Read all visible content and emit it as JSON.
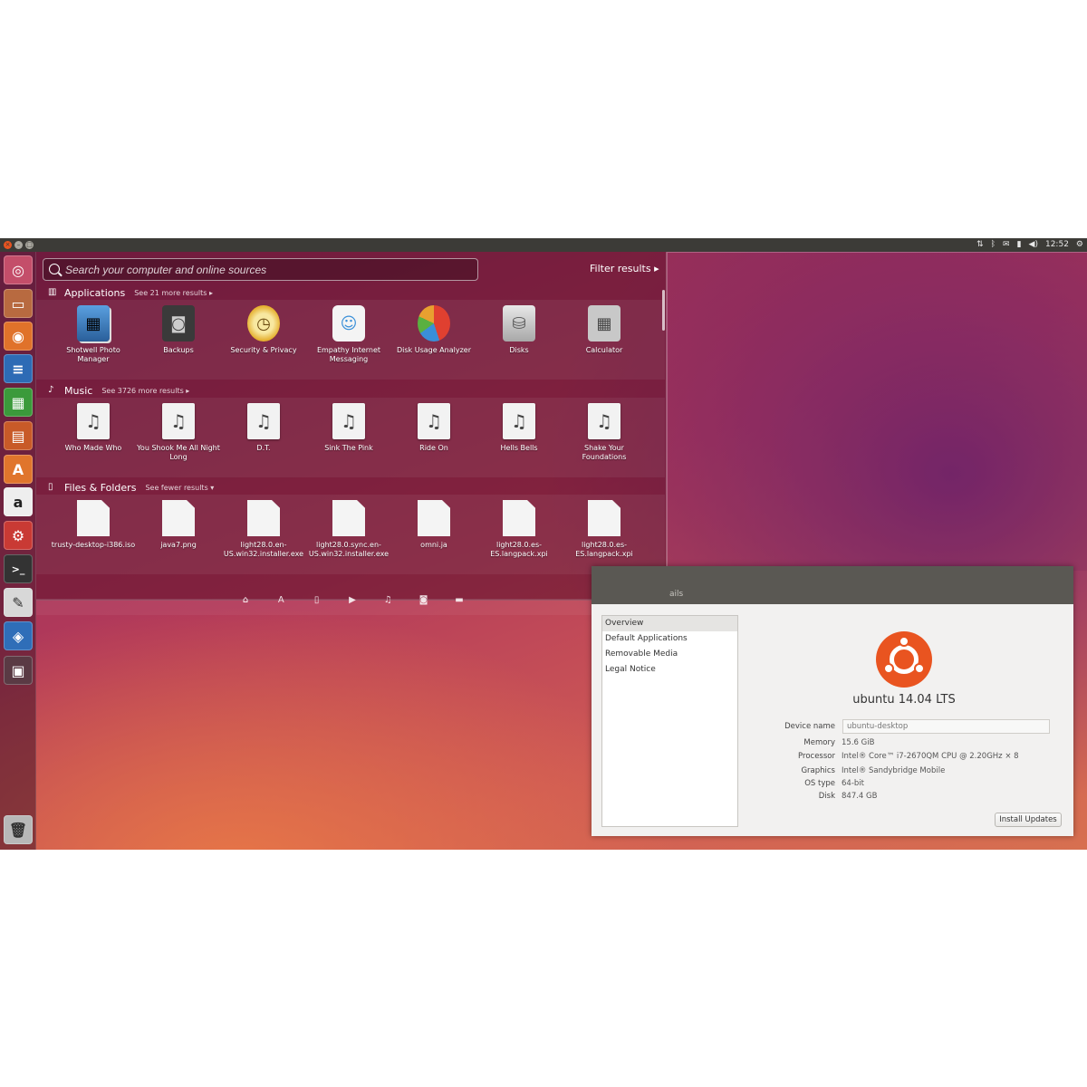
{
  "top_panel": {
    "time": "12:52",
    "indicators": [
      "network-icon",
      "bluetooth-icon",
      "mail-icon",
      "battery-icon",
      "volume-icon",
      "gear-icon"
    ]
  },
  "launcher": {
    "items": [
      "dash-home-icon",
      "files-icon",
      "firefox-icon",
      "writer-icon",
      "calc-icon",
      "impress-icon",
      "software-center-icon",
      "amazon-icon",
      "system-settings-icon",
      "terminal-icon",
      "text-editor-icon",
      "virtualbox-icon",
      "workspace-switcher-icon",
      "trash-icon"
    ]
  },
  "dash": {
    "search_placeholder": "Search your computer and online sources",
    "filter_results": "Filter results",
    "categories": {
      "applications": {
        "title": "Applications",
        "more": "See 21 more results",
        "items": [
          {
            "label": "Shotwell Photo Manager",
            "icon": "shotwell-icon"
          },
          {
            "label": "Backups",
            "icon": "backups-icon"
          },
          {
            "label": "Security & Privacy",
            "icon": "security-privacy-icon"
          },
          {
            "label": "Empathy Internet Messaging",
            "icon": "empathy-icon"
          },
          {
            "label": "Disk Usage Analyzer",
            "icon": "disk-usage-icon"
          },
          {
            "label": "Disks",
            "icon": "disks-icon"
          },
          {
            "label": "Calculator",
            "icon": "calculator-icon"
          }
        ]
      },
      "music": {
        "title": "Music",
        "more": "See 3726 more results",
        "items": [
          {
            "label": "Who Made Who"
          },
          {
            "label": "You Shook Me All Night Long"
          },
          {
            "label": "D.T."
          },
          {
            "label": "Sink The Pink"
          },
          {
            "label": "Ride On"
          },
          {
            "label": "Hells Bells"
          },
          {
            "label": "Shake Your Foundations"
          }
        ]
      },
      "files": {
        "title": "Files & Folders",
        "more": "See fewer results",
        "items": [
          {
            "label": "trusty-desktop-i386.iso"
          },
          {
            "label": "java7.png"
          },
          {
            "label": "light28.0.en-US.win32.installer.exe"
          },
          {
            "label": "light28.0.sync.en-US.win32.installer.exe"
          },
          {
            "label": "omni.ja"
          },
          {
            "label": "light28.0.es-ES.langpack.xpi"
          },
          {
            "label": "light28.0.es-ES.langpack.xpi"
          }
        ]
      }
    },
    "lenses": [
      "home-lens-icon",
      "applications-lens-icon",
      "files-lens-icon",
      "video-lens-icon",
      "music-lens-icon",
      "photos-lens-icon",
      "social-lens-icon"
    ]
  },
  "details": {
    "title": "ails",
    "sidebar": [
      "Overview",
      "Default Applications",
      "Removable Media",
      "Legal Notice"
    ],
    "selected_index": 0,
    "os_name": "ubuntu 14.04 LTS",
    "device_name_label": "Device name",
    "device_name_value": "ubuntu-desktop",
    "rows": [
      {
        "label": "Memory",
        "value": "15.6 GiB"
      },
      {
        "label": "Processor",
        "value": "Intel® Core™ i7-2670QM CPU @ 2.20GHz × 8"
      },
      {
        "label": "Graphics",
        "value": "Intel® Sandybridge Mobile"
      },
      {
        "label": "OS type",
        "value": "64-bit"
      },
      {
        "label": "Disk",
        "value": "847.4 GB"
      }
    ],
    "install_updates": "Install Updates"
  },
  "colors": {
    "accent": "#e95420",
    "panel": "#3c3b37"
  }
}
